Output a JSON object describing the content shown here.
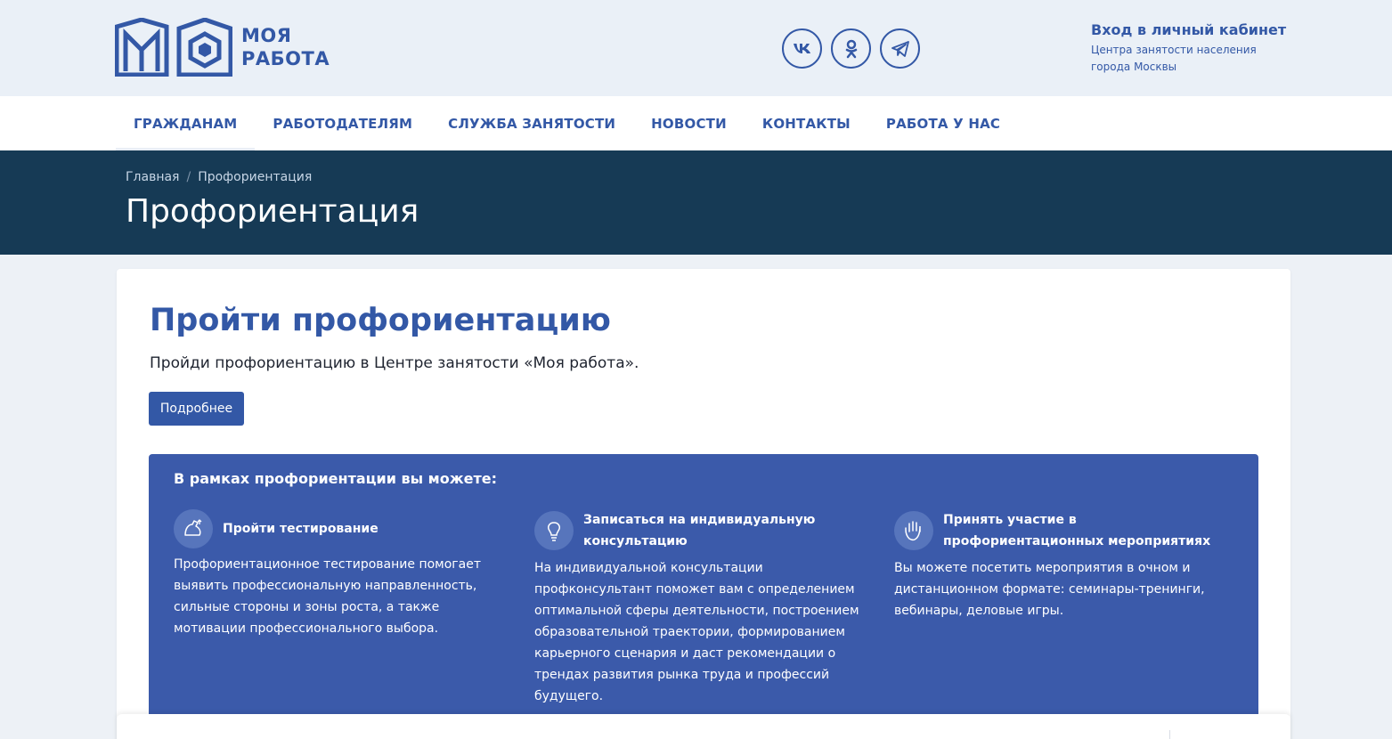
{
  "header": {
    "logo_line1": "МОЯ",
    "logo_line2": "РАБОТА",
    "socials": [
      {
        "label": "vk"
      },
      {
        "label": "ok"
      },
      {
        "label": "telegram"
      }
    ],
    "cabinet_title": "Вход в личный кабинет",
    "cabinet_sub": "Центра занятости населения города Москвы"
  },
  "nav": {
    "items": [
      {
        "label": "ГРАЖДАНАМ"
      },
      {
        "label": "РАБОТОДАТЕЛЯМ"
      },
      {
        "label": "СЛУЖБА ЗАНЯТОСТИ"
      },
      {
        "label": "НОВОСТИ"
      },
      {
        "label": "КОНТАКТЫ"
      },
      {
        "label": "РАБОТА У НАС"
      }
    ]
  },
  "banner": {
    "breadcrumb": [
      "Главная",
      "/",
      "Профориентация"
    ],
    "title": "Профориентация"
  },
  "main": {
    "title": "Пройти профориентацию",
    "text": "Пройди профориентацию в Центре занятости «Моя работа».",
    "button": "Подробнее",
    "features_title": "В рамках профориентации вы можете:",
    "features": [
      {
        "name": "Пройти тестирование",
        "desc": "Профориентационное тестирование помогает выявить профессиональную направленность, сильные стороны и зоны роста, а также мотивации профессионального выбора."
      },
      {
        "name": "Записаться на индивидуальную консультацию",
        "desc": "На индивидуальной консультации профконсультант поможет вам с определением оптимальной сферы деятельности, построением образовательной траектории, формированием карьерного сценария и даст рекомендации о трендах развития рынка труда и профессий будущего."
      },
      {
        "name": "Принять участие в профориентационных мероприятиях",
        "desc": "Вы можете посетить мероприятия в очном и дистанционном формате: семинары-тренинги, вебинары, деловые игры."
      }
    ]
  },
  "colors": {
    "brand": "#3358a6",
    "banner": "#163a55",
    "features_bg": "#3b5aaa"
  }
}
